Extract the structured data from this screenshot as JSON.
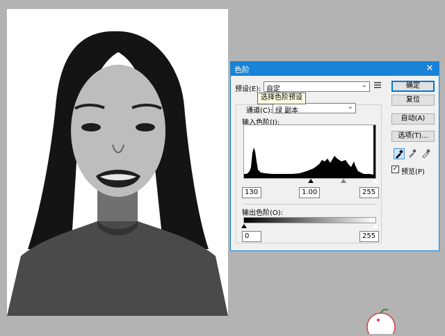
{
  "dialog": {
    "title": "色阶",
    "close_label": "✕",
    "preset_label": "预设(E):",
    "preset_value": "自定",
    "preset_menu_icon": "list-menu-icon",
    "tooltip": "选择色阶预设",
    "channel_label": "通道(C):",
    "channel_value": "绿 副本",
    "input_levels_label": "输入色阶(I):",
    "input_black": "130",
    "input_gamma": "1.00",
    "input_white": "255",
    "output_levels_label": "输出色阶(O):",
    "output_black": "0",
    "output_white": "255",
    "histogram_sliders": {
      "black_pos": 0.51,
      "gray_pos": 0.75,
      "white_pos": 1.0
    },
    "buttons": {
      "ok": "确定",
      "reset": "复位",
      "auto": "自动(A)",
      "options": "选项(T)..."
    },
    "preview_label": "预览(P)",
    "preview_checked": true
  },
  "colors": {
    "titlebar": "#1883d7",
    "workspace": "#b3b3b3"
  }
}
